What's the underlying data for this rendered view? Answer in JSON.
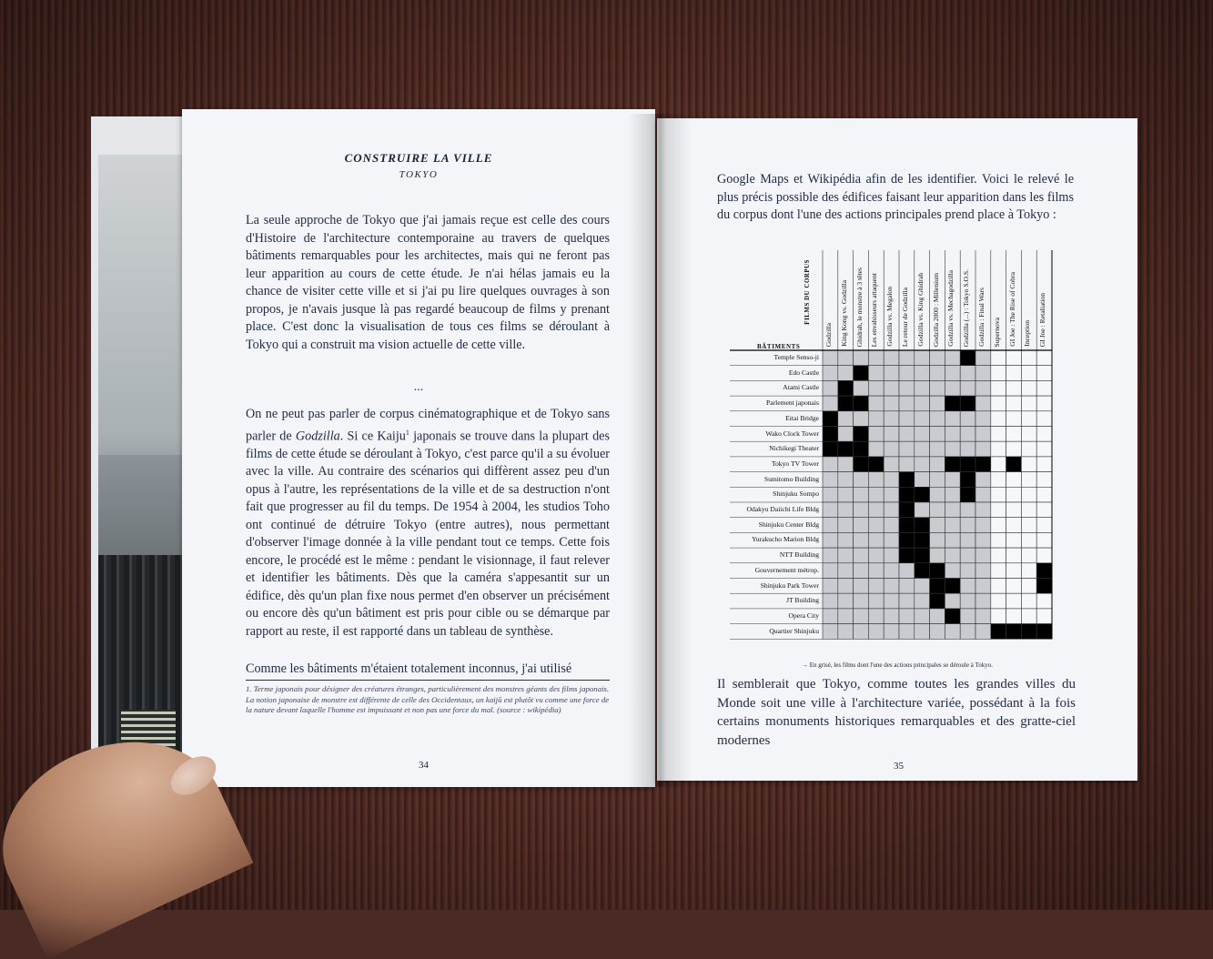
{
  "left_page": {
    "title": "CONSTRUIRE LA VILLE",
    "subtitle": "TOKYO",
    "paragraph1": "La seule approche de Tokyo que j'ai jamais reçue est celle des cours d'Histoire de l'architecture contemporaine au travers de quelques bâtiments remarquables pour les architectes, mais qui ne feront pas leur apparition au cours de cette étude. Je n'ai hélas jamais eu la chance de visiter cette ville et si j'ai pu lire quelques ouvrages à son propos, je n'avais jusque là pas regardé beaucoup de films y prenant place. C'est donc la visualisation de tous ces films se déroulant à Tokyo qui a construit ma vision actuelle de cette ville.",
    "dots": "...",
    "paragraph2_a": "On ne peut pas parler de corpus cinématographique et de Tokyo sans parler de ",
    "paragraph2_italic": "Godzilla",
    "paragraph2_b": ". Si ce Kaiju",
    "paragraph2_sup": "1",
    "paragraph2_c": " japonais se trouve dans la plupart des films de cette étude se déroulant à Tokyo, c'est parce qu'il a su évoluer avec la ville. Au contraire des scénarios qui diffèrent assez peu d'un opus à l'autre, les représentations de la ville et de sa destruction n'ont fait que progresser au fil du temps. De 1954 à 2004, les studios Toho ont continué de détruire Tokyo (entre autres), nous permettant d'observer l'image donnée à la ville pendant tout ce temps. Cette fois encore, le procédé est le même : pendant le visionnage, il faut relever et identifier les bâtiments. Dès que la caméra s'appesantit sur un édifice, dès qu'un plan fixe nous permet d'en observer un précisément ou encore dès qu'un bâtiment est pris pour cible ou se démarque par rapport au reste, il est rapporté dans un tableau de synthèse.",
    "paragraph3": "Comme les bâtiments m'étaient totalement inconnus, j'ai utilisé",
    "footnote": "1. Terme japonais pour désigner des créatures étranges, particulièrement des monstres géants des films japonais. La notion japonaise de monstre est différente de celle des Occidentaux, un kaijû est plutôt vu comme une force de la nature devant laquelle l'homme est impuissant et non pas une force du mal. (source : wikipédia)",
    "page_number": "34"
  },
  "right_page": {
    "paragraph1": "Google Maps et Wikipédia afin de les identifier. Voici le relevé le plus précis possible des édifices faisant leur apparition dans les films du corpus dont l'une des actions principales prend place à Tokyo :",
    "paragraph2": "Il semblerait que Tokyo, comme toutes les grandes villes du Monde soit une ville à l'architecture variée, possédant à la fois certains monuments historiques remarquables et des gratte-ciel modernes",
    "caption": "→ En grisé, les films dont l'une des actions principales se déroule à Tokyo.",
    "page_number": "35"
  },
  "table": {
    "films_label": "FILMS DU CORPUS",
    "buildings_label": "BÂTIMENTS",
    "films": [
      "Godzilla",
      "King Kong vs. Godzilla",
      "Ghidrah, le monstre à 3 têtes",
      "Les envahisseurs attaquent",
      "Godzilla vs. Megalon",
      "Le retour de Godzilla",
      "Godzilla vs. King Ghidrah",
      "Godzilla 2000 : Millenium",
      "Godzilla vs. Mechagodzilla",
      "Godzilla (...) : Tokyo S.O.S.",
      "Godzilla : Final Wars",
      "Supernova",
      "GI Joe : The Rise of Cobra",
      "Inception",
      "GI Joe : Retaliation"
    ],
    "tokyo_films": [
      true,
      true,
      true,
      true,
      true,
      true,
      true,
      true,
      true,
      true,
      true,
      false,
      false,
      false,
      false
    ],
    "buildings": [
      "Temple Senso-ji",
      "Edo Castle",
      "Atami Castle",
      "Parlement japonais",
      "Eitai Bridge",
      "Wako Clock Tower",
      "Nichikegi Theater",
      "Tokyo TV Tower",
      "Sumitomo Building",
      "Shinjuku Sompo",
      "Odakyu Daiichi Life Bldg",
      "Shinjuku Center Bldg",
      "Yurakucho Marion Bldg",
      "NTT Building",
      "Gouvernement métrop.",
      "Shinjuku Park Tower",
      "JT Building",
      "Opera City",
      "Quartier Shinjuku"
    ],
    "presence": [
      [
        0,
        0,
        0,
        0,
        0,
        0,
        0,
        0,
        0,
        1,
        0,
        0,
        0,
        0,
        0
      ],
      [
        0,
        0,
        1,
        0,
        0,
        0,
        0,
        0,
        0,
        0,
        0,
        0,
        0,
        0,
        0
      ],
      [
        0,
        1,
        0,
        0,
        0,
        0,
        0,
        0,
        0,
        0,
        0,
        0,
        0,
        0,
        0
      ],
      [
        0,
        1,
        1,
        0,
        0,
        0,
        0,
        0,
        1,
        1,
        0,
        0,
        0,
        0,
        0
      ],
      [
        1,
        0,
        0,
        0,
        0,
        0,
        0,
        0,
        0,
        0,
        0,
        0,
        0,
        0,
        0
      ],
      [
        1,
        0,
        1,
        0,
        0,
        0,
        0,
        0,
        0,
        0,
        0,
        0,
        0,
        0,
        0
      ],
      [
        1,
        1,
        1,
        0,
        0,
        0,
        0,
        0,
        0,
        0,
        0,
        0,
        0,
        0,
        0
      ],
      [
        0,
        0,
        1,
        1,
        0,
        0,
        0,
        0,
        1,
        1,
        1,
        0,
        1,
        0,
        0
      ],
      [
        0,
        0,
        0,
        0,
        0,
        1,
        0,
        0,
        0,
        1,
        0,
        0,
        0,
        0,
        0
      ],
      [
        0,
        0,
        0,
        0,
        0,
        1,
        1,
        0,
        0,
        1,
        0,
        0,
        0,
        0,
        0
      ],
      [
        0,
        0,
        0,
        0,
        0,
        1,
        0,
        0,
        0,
        0,
        0,
        0,
        0,
        0,
        0
      ],
      [
        0,
        0,
        0,
        0,
        0,
        1,
        1,
        0,
        0,
        0,
        0,
        0,
        0,
        0,
        0
      ],
      [
        0,
        0,
        0,
        0,
        0,
        1,
        1,
        0,
        0,
        0,
        0,
        0,
        0,
        0,
        0
      ],
      [
        0,
        0,
        0,
        0,
        0,
        1,
        1,
        0,
        0,
        0,
        0,
        0,
        0,
        0,
        0
      ],
      [
        0,
        0,
        0,
        0,
        0,
        0,
        1,
        1,
        0,
        0,
        0,
        0,
        0,
        0,
        1
      ],
      [
        0,
        0,
        0,
        0,
        0,
        0,
        0,
        1,
        1,
        0,
        0,
        0,
        0,
        0,
        1
      ],
      [
        0,
        0,
        0,
        0,
        0,
        0,
        0,
        1,
        0,
        0,
        0,
        0,
        0,
        0,
        0
      ],
      [
        0,
        0,
        0,
        0,
        0,
        0,
        0,
        0,
        1,
        0,
        0,
        0,
        0,
        0,
        0
      ],
      [
        0,
        0,
        0,
        0,
        0,
        0,
        0,
        0,
        0,
        0,
        0,
        1,
        1,
        1,
        1
      ]
    ],
    "colors": {
      "tokyo_film_fill": "#c9cbd0",
      "other_fill": "#f6f7f9",
      "present_fill": "#000000",
      "grid": "#333333"
    }
  }
}
